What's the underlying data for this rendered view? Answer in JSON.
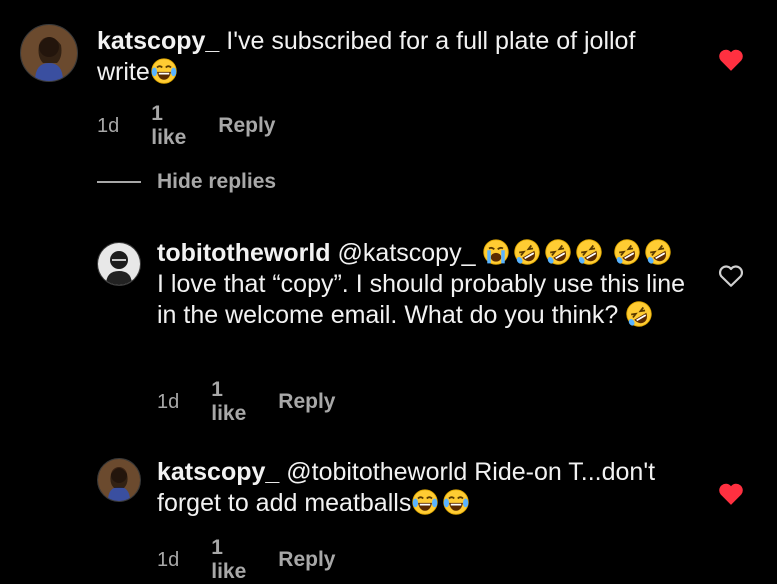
{
  "comments": [
    {
      "username": "katscopy_",
      "text": "I've subscribed for a full plate of jollof write",
      "emojis": [
        "laugh-tears"
      ],
      "time": "1d",
      "likes": "1 like",
      "reply_label": "Reply",
      "liked": true
    },
    {
      "username": "tobitotheworld",
      "mention": "@katscopy_",
      "emojis_after_mention": [
        "crying",
        "rofl",
        "rofl",
        "rofl",
        "rofl",
        "rofl"
      ],
      "text": "I love that “copy”. I should probably use this line in the welcome email. What do you think?",
      "emojis_after_text": [
        "rofl"
      ],
      "time": "1d",
      "likes": "1 like",
      "reply_label": "Reply",
      "liked": false
    },
    {
      "username": "katscopy_",
      "mention": "@tobitotheworld",
      "text": "Ride-on T...don't forget to add meatballs",
      "emojis": [
        "laugh-tears",
        "laugh-tears"
      ],
      "time": "1d",
      "likes": "1 like",
      "reply_label": "Reply",
      "liked": true
    }
  ],
  "hide_replies_label": "Hide replies",
  "colors": {
    "background": "#000000",
    "heart_liked": "#ff3040",
    "muted": "#a8a8a8"
  }
}
